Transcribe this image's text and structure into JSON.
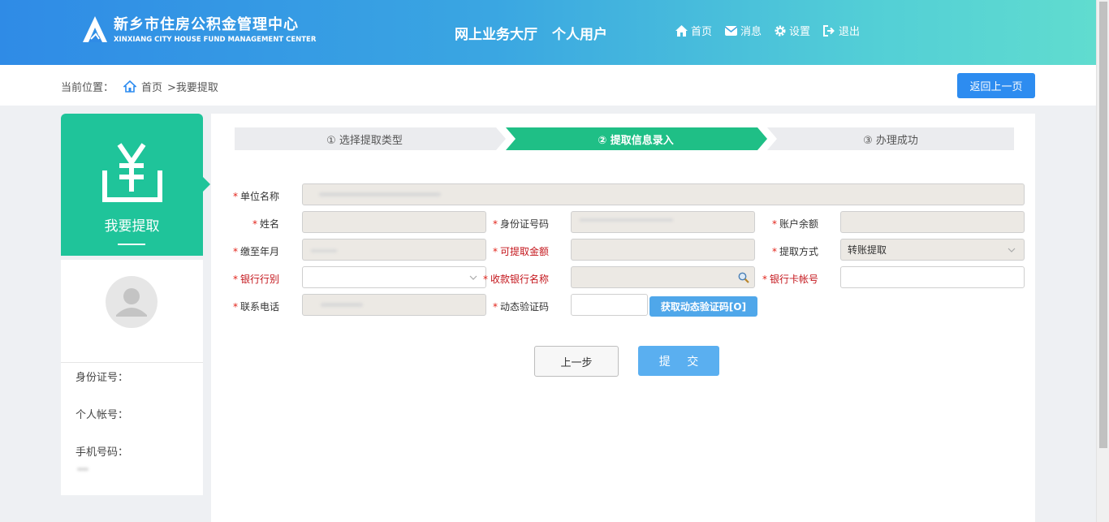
{
  "header": {
    "logo_cn": "新乡市住房公积金管理中心",
    "logo_en": "XINXIANG CITY HOUSE FUND MANAGEMENT CENTER",
    "portal": "网上业务大厅",
    "user_type": "个人用户",
    "nav": [
      {
        "label": "首页",
        "icon": "home-icon"
      },
      {
        "label": "消息",
        "icon": "mail-icon"
      },
      {
        "label": "设置",
        "icon": "gear-icon"
      },
      {
        "label": "退出",
        "icon": "logout-icon"
      }
    ]
  },
  "breadcrumb": {
    "prefix": "当前位置：",
    "home": "首页",
    "current": ">我要提取"
  },
  "back_button": "返回上一页",
  "sidebar": {
    "card_title": "我要提取",
    "fields": {
      "id_label": "身份证号：",
      "account_label": "个人帐号：",
      "phone_label": "手机号码："
    }
  },
  "steps": [
    {
      "label": "① 选择提取类型",
      "active": false
    },
    {
      "label": "② 提取信息录入",
      "active": true
    },
    {
      "label": "③ 办理成功",
      "active": false
    }
  ],
  "form": {
    "company_label": "单位名称",
    "name_label": "姓名",
    "id_label": "身份证号码",
    "balance_label": "账户余额",
    "paid_until_label": "缴至年月",
    "withdrawable_label": "可提取金额",
    "method_label": "提取方式",
    "method_value": "转账提取",
    "bank_type_label": "银行行别",
    "bank_name_label": "收款银行名称",
    "card_no_label": "银行卡帐号",
    "phone_label": "联系电话",
    "code_label": "动态验证码",
    "get_code_button": "获取动态验证码[O]"
  },
  "buttons": {
    "prev": "上一步",
    "submit": "提 交"
  },
  "colors": {
    "brand_green": "#1fc49a",
    "step_active": "#1fbf86",
    "primary_blue": "#2d8cf0",
    "required_red": "#e2231a"
  }
}
